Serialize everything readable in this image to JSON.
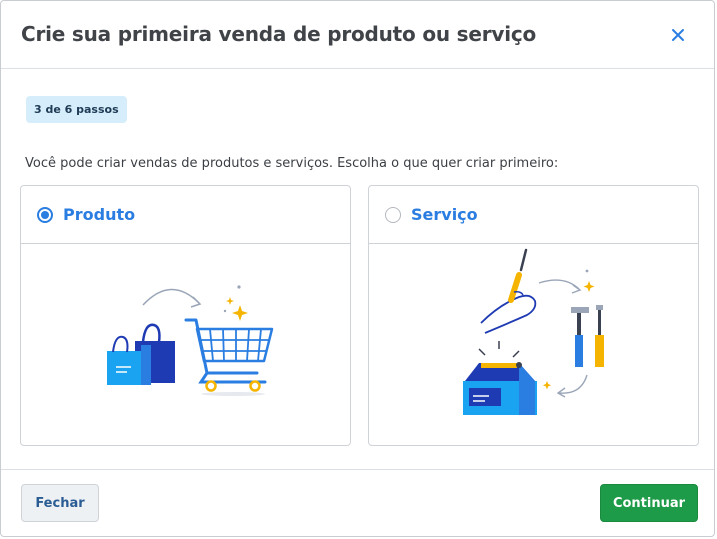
{
  "modal": {
    "title": "Crie sua primeira venda de produto ou serviço",
    "step_badge": "3 de 6 passos",
    "intro": "Você pode criar vendas de produtos e serviços. Escolha o que quer criar primeiro:"
  },
  "options": [
    {
      "label": "Produto",
      "selected": true,
      "illustration": "shopping-cart-bags"
    },
    {
      "label": "Serviço",
      "selected": false,
      "illustration": "tools-toolbox"
    }
  ],
  "footer": {
    "close_label": "Fechar",
    "continue_label": "Continuar"
  },
  "colors": {
    "accent": "#2a7de1",
    "primary_button": "#1e9b48",
    "badge_bg": "#d6eefb"
  }
}
